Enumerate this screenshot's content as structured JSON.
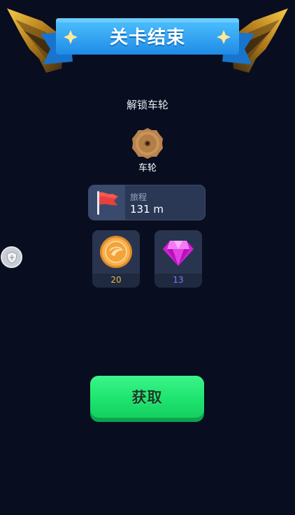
{
  "banner": {
    "title": "关卡结束"
  },
  "unlock": {
    "label": "解锁车轮",
    "item_name": "车轮",
    "item_icon": "wooden-wheel-icon"
  },
  "distance": {
    "label": "旅程",
    "value": "131 m",
    "icon": "red-flag-icon"
  },
  "rewards": {
    "coins": {
      "count": "20",
      "icon": "gold-coin-icon"
    },
    "gems": {
      "count": "13",
      "icon": "pink-gem-icon"
    }
  },
  "side_button": {
    "icon": "shield-icon"
  },
  "get_button": {
    "label": "获取"
  },
  "colors": {
    "background": "#080e1f",
    "banner_blue": "#2a9df4",
    "button_green": "#1ee46f",
    "coin_text": "#f2b24a",
    "gem_text": "#8e74ff"
  }
}
